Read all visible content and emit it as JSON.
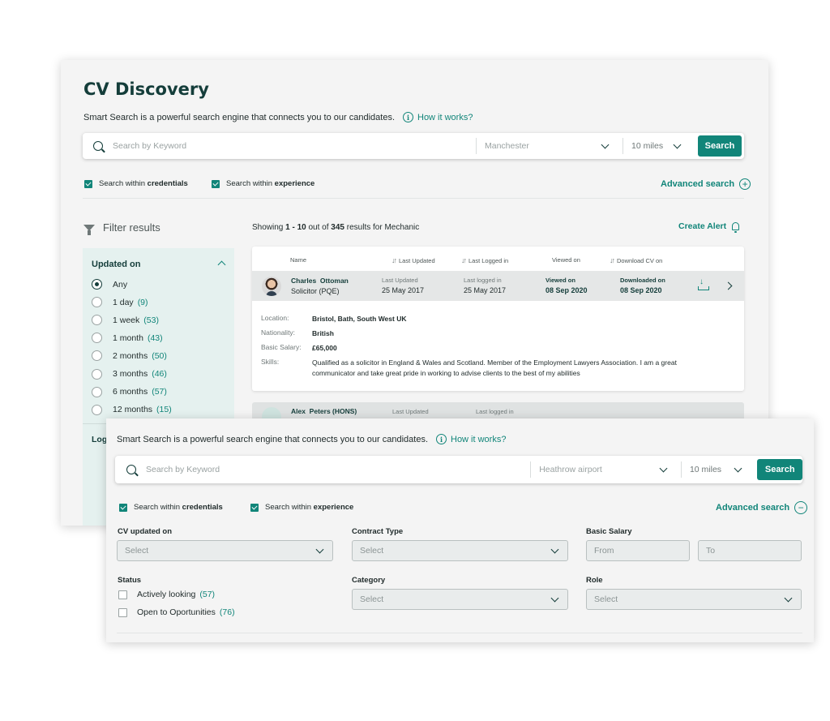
{
  "back": {
    "title": "CV Discovery",
    "intro": "Smart Search is a powerful search engine that connects you to our candidates.",
    "how_it_works": "How it works?",
    "search": {
      "keyword_placeholder": "Search by Keyword",
      "location": "Manchester",
      "radius": "10 miles",
      "button": "Search"
    },
    "checks": {
      "credentials_prefix": "Search within ",
      "credentials_bold": "credentials",
      "experience_prefix": "Search within ",
      "experience_bold": "experience"
    },
    "advanced_search": "Advanced search",
    "filter_title": "Filter results",
    "updated_on": {
      "heading": "Updated on",
      "options": [
        {
          "label": "Any",
          "count": "",
          "selected": true
        },
        {
          "label": "1 day",
          "count": "(9)",
          "selected": false
        },
        {
          "label": "1 week",
          "count": "(53)",
          "selected": false
        },
        {
          "label": "1 month",
          "count": "(43)",
          "selected": false
        },
        {
          "label": "2 months",
          "count": "(50)",
          "selected": false
        },
        {
          "label": "3 months",
          "count": "(46)",
          "selected": false
        },
        {
          "label": "6 months",
          "count": "(57)",
          "selected": false
        },
        {
          "label": "12 months",
          "count": "(15)",
          "selected": false
        }
      ]
    },
    "login_heading": "Log",
    "results": {
      "prefix": "Showing ",
      "range": "1 - 10",
      "mid": " out of ",
      "total": "345",
      "suffix": " results for Mechanic"
    },
    "create_alert": "Create Alert",
    "table_headers": {
      "name": "Name",
      "last_updated": "Last Updated",
      "last_logged": "Last Logged in",
      "viewed_on": "Viewed on",
      "download": "Download CV on"
    },
    "candidate": {
      "first": "Charles",
      "last": "Ottoman",
      "role": "Solicitor (PQE)",
      "last_updated_label": "Last Updated",
      "last_updated": "25 May 2017",
      "last_logged_label": "Last logged in",
      "last_logged": "25 May 2017",
      "viewed_label": "Viewed on",
      "viewed": "08 Sep 2020",
      "downloaded_label": "Downloaded on",
      "downloaded": "08 Sep 2020",
      "location_label": "Location:",
      "location": "Bristol, Bath, South West UK",
      "nationality_label": "Nationality:",
      "nationality": "British",
      "salary_label": "Basic Salary:",
      "salary": "£65,000",
      "skills_label": "Skills:",
      "skills": "Qualified as a solicitor in England & Wales and Scotland. Member of the Employment Lawyers Association. I am a great communicator and take great pride in working to advise clients to the best of my abilities"
    },
    "candidate2": {
      "name": "Alex  Peters (HONS)",
      "last_updated_label": "Last Updated",
      "last_logged_label": "Last logged in"
    }
  },
  "front": {
    "intro": "Smart Search is a powerful search engine that connects you to our candidates.",
    "how_it_works": "How it works?",
    "search": {
      "keyword_placeholder": "Search by Keyword",
      "location": "Heathrow airport",
      "radius": "10 miles",
      "button": "Search"
    },
    "checks": {
      "credentials_prefix": "Search within ",
      "credentials_bold": "credentials",
      "experience_prefix": "Search within ",
      "experience_bold": "experience"
    },
    "advanced_search": "Advanced search",
    "cv_updated_label": "CV updated on",
    "cv_updated_value": "Select",
    "contract_label": "Contract Type",
    "contract_value": "Select",
    "salary_label": "Basic Salary",
    "salary_from": "From",
    "salary_to": "To",
    "status_label": "Status",
    "status_options": [
      {
        "label": "Actively looking",
        "count": "(57)"
      },
      {
        "label": "Open to Oportunities",
        "count": "(76)"
      }
    ],
    "category_label": "Category",
    "category_value": "Select",
    "role_label": "Role",
    "role_value": "Select"
  },
  "colors": {
    "accent": "#118579",
    "dark": "#143d3a",
    "panel": "#e5f1ef"
  }
}
